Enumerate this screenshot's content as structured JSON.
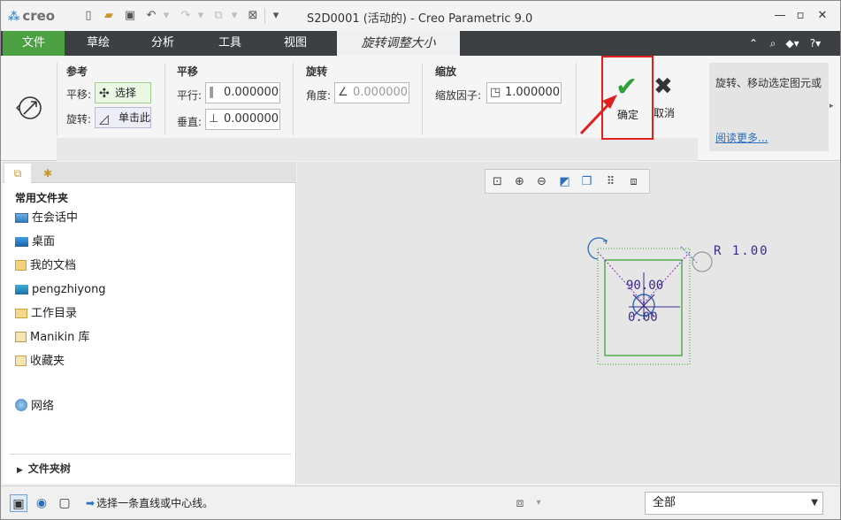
{
  "titlebar": {
    "logo": "creo",
    "window_title": "S2D0001 (活动的) - Creo Parametric 9.0"
  },
  "tabs": {
    "file": "文件",
    "sketch": "草绘",
    "analysis": "分析",
    "tools": "工具",
    "view": "视图",
    "active": "旋转调整大小"
  },
  "ribbon": {
    "references": {
      "title": "参考",
      "translate_label": "平移:",
      "translate_button": "选择",
      "rotate_label": "旋转:",
      "rotate_button": "单击此"
    },
    "translate": {
      "title": "平移",
      "horizontal_label": "平行:",
      "horizontal_value": "0.000000",
      "vertical_label": "垂直:",
      "vertical_value": "0.000000"
    },
    "rotate": {
      "title": "旋转",
      "angle_label": "角度:",
      "angle_value": "0.000000"
    },
    "scale": {
      "title": "缩放",
      "factor_label": "缩放因子:",
      "factor_value": "1.000000"
    },
    "ok_label": "确定",
    "cancel_label": "取消",
    "help": {
      "text": "旋转、移动选定图元或",
      "link": "阅读更多..."
    }
  },
  "navigator": {
    "heading": "常用文件夹",
    "items": [
      {
        "label": "在会话中",
        "icon": "monitor-icon"
      },
      {
        "label": "桌面",
        "icon": "desktop-icon"
      },
      {
        "label": "我的文档",
        "icon": "documents-icon"
      },
      {
        "label": "pengzhiyong",
        "icon": "computer-icon"
      },
      {
        "label": "工作目录",
        "icon": "working-folder-icon"
      },
      {
        "label": "Manikin 库",
        "icon": "library-icon"
      },
      {
        "label": "收藏夹",
        "icon": "favorites-icon"
      },
      {
        "label": "网络",
        "icon": "network-icon"
      }
    ],
    "folder_tree": "文件夹树"
  },
  "graphics": {
    "dimension_radius": "R 1.00",
    "dimension_angle": "90.00",
    "dimension_offset": "0.00"
  },
  "statusbar": {
    "message": "选择一条直线或中心线。",
    "filter_value": "全部"
  },
  "colors": {
    "file_tab": "#4ca243",
    "tab_bar": "#3c4043",
    "sketch_green": "#2aa02a",
    "dimension_purple": "#3b2a8a",
    "highlight_red": "#e02020"
  }
}
